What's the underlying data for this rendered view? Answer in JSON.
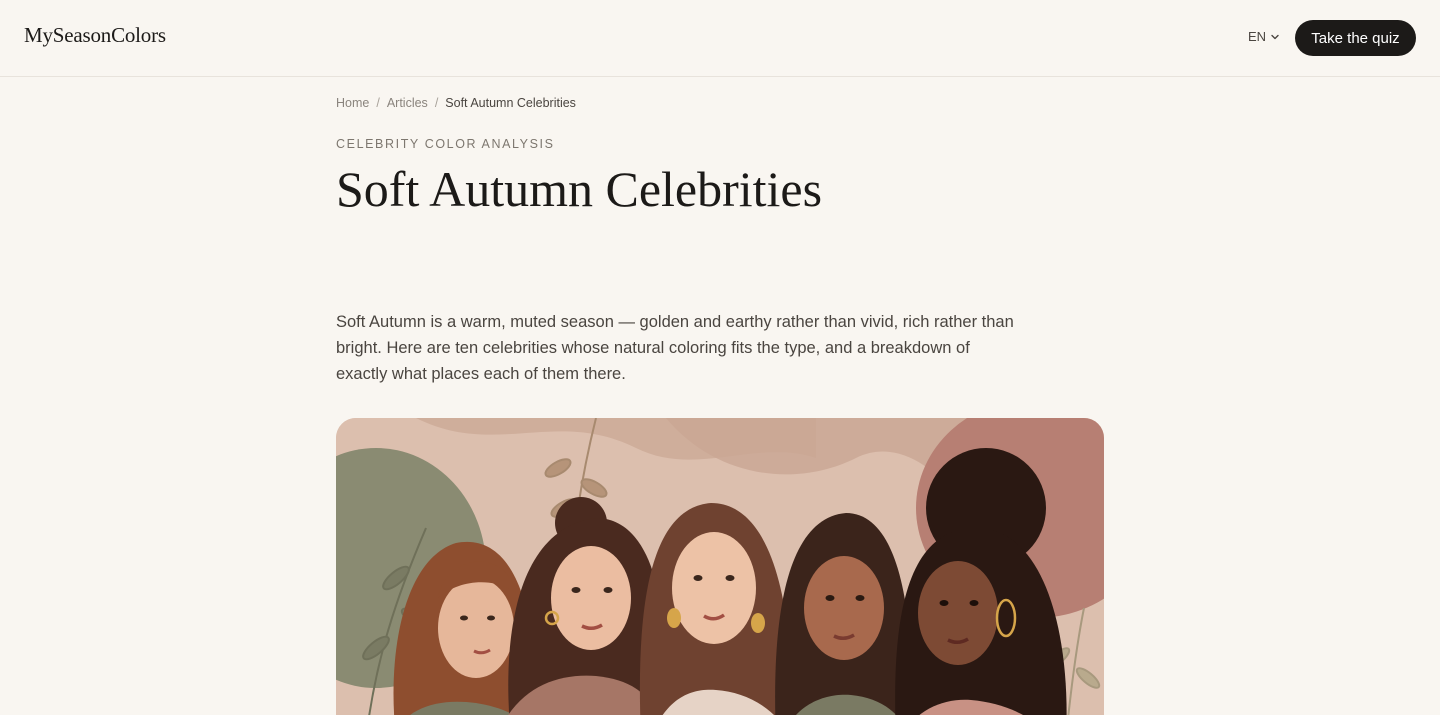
{
  "header": {
    "logo": "MySeasonColors",
    "language": "EN",
    "cta_label": "Take the quiz"
  },
  "breadcrumb": {
    "items": [
      "Home",
      "Articles",
      "Soft Autumn Celebrities"
    ],
    "separator": "/"
  },
  "article": {
    "eyebrow": "CELEBRITY COLOR ANALYSIS",
    "title": "Soft Autumn Celebrities",
    "lede": "Soft Autumn is a warm, muted season — golden and earthy rather than vivid, rich rather than bright. Here are ten celebrities whose natural coloring fits the type, and a breakdown of exactly what places each of them there."
  },
  "hero_image": {
    "icon": "illustration-five-women",
    "colors": {
      "background": "#dcbfae",
      "sage": "#8a8b72",
      "rose": "#b77f73",
      "sweater_rose": "#a67666",
      "sweater_sage": "#7a7a63"
    }
  },
  "colors": {
    "page_bg": "#f9f6f1",
    "ink": "#1c1a18",
    "muted": "#7d776f"
  }
}
